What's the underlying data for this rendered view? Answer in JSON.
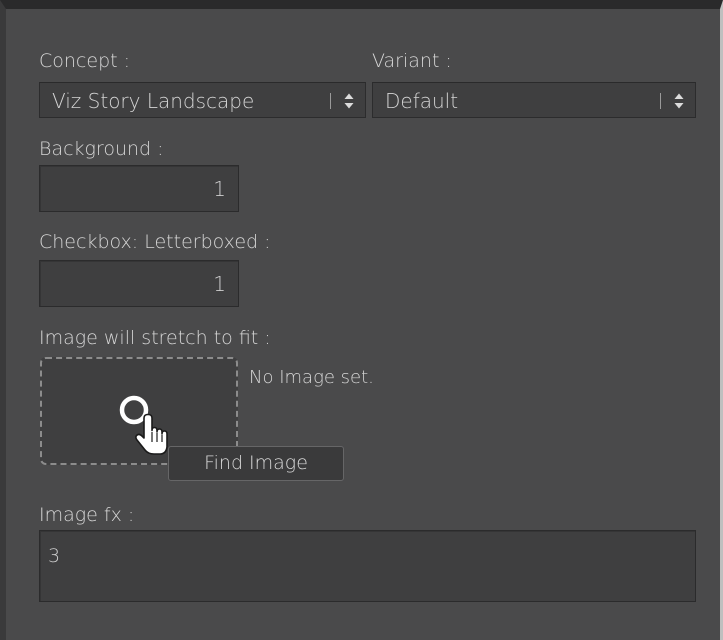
{
  "concept": {
    "label": "Concept :",
    "selected": "Viz Story Landscape"
  },
  "variant": {
    "label": "Variant :",
    "selected": "Default"
  },
  "background": {
    "label": "Background :",
    "value": "1"
  },
  "letterboxed": {
    "label": "Checkbox: Letterboxed :",
    "value": "1"
  },
  "image": {
    "label": "Image will stretch to fit :",
    "status": "No Image set.",
    "find_button": "Find Image"
  },
  "image_fx": {
    "label": "Image fx :",
    "value": "3"
  },
  "icons": {
    "select_arrows": "up-down-chevron-icon",
    "cursor": "hand-pointer-icon",
    "spinner": "loading-ring-icon"
  }
}
